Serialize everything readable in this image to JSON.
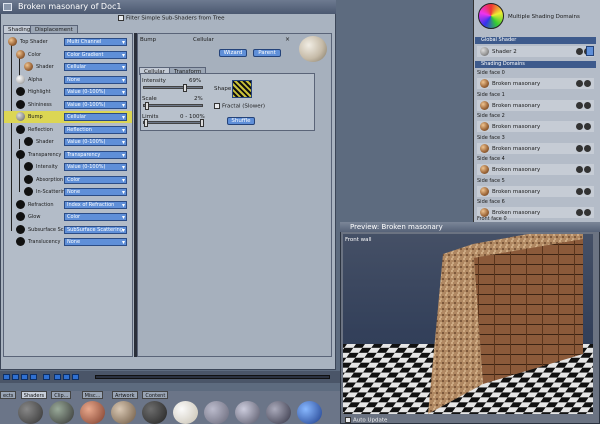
{
  "window": {
    "title": "Broken masonary of Doc1",
    "filter_label": "Filter Simple Sub-Shaders from Tree",
    "tabs": [
      "Shading",
      "Displacement"
    ]
  },
  "tree": [
    {
      "label": "Top Shader",
      "value": "Multi Channel",
      "ball": "brick"
    },
    {
      "label": "Color",
      "value": "Color Gradient",
      "ball": "brick"
    },
    {
      "label": "Shader",
      "value": "Cellular",
      "ball": "brick"
    },
    {
      "label": "Alpha",
      "value": "None",
      "ball": "white"
    },
    {
      "label": "Highlight",
      "value": "Value (0-100%)",
      "ball": "dark"
    },
    {
      "label": "Shininess",
      "value": "Value (0-100%)",
      "ball": "dark"
    },
    {
      "label": "Bump",
      "value": "Cellular",
      "ball": "grey"
    },
    {
      "label": "Reflection",
      "value": "Reflection",
      "ball": "dark"
    },
    {
      "label": "Shader",
      "value": "Value (0-100%)",
      "ball": "dark"
    },
    {
      "label": "Transparency",
      "value": "Transparency",
      "ball": "dark"
    },
    {
      "label": "Intensity",
      "value": "Value (0-100%)",
      "ball": "dark"
    },
    {
      "label": "Absorption",
      "value": "Color",
      "ball": "dark"
    },
    {
      "label": "In-Scattering",
      "value": "None",
      "ball": "dark"
    },
    {
      "label": "Refraction",
      "value": "Index of Refraction",
      "ball": "dark"
    },
    {
      "label": "Glow",
      "value": "Color",
      "ball": "dark"
    },
    {
      "label": "Subsurface Sc",
      "value": "SubSurface Scattering",
      "ball": "dark"
    },
    {
      "label": "Translucency",
      "value": "None",
      "ball": "dark"
    }
  ],
  "bump_panel": {
    "label": "Bump",
    "type": "Cellular",
    "wizard_label": "Wizard",
    "parent_label": "Parent",
    "tabs": [
      "Cellular",
      "Transform"
    ],
    "intensity_label": "Intensity",
    "intensity_value": "69%",
    "intensity_level": 0.69,
    "scale_label": "Scale",
    "scale_value": "2%",
    "scale_level": 0.02,
    "limits_label": "Limits",
    "limits_value": "0 - 100%",
    "shape_label": "Shape",
    "fractal_label": "Fractal (Slower)",
    "shuffle_label": "Shuffle"
  },
  "library_tabs": [
    "ects",
    "Shaders",
    "Clip...",
    "Misc...",
    "Artwork",
    "Content"
  ],
  "side_panel": {
    "multi_label": "Multiple Shading Domains",
    "global_header": "Global Shader",
    "global_shader": "Shader 2",
    "domains_header": "Shading Domains",
    "faces": [
      {
        "label": "Side face 0",
        "shader": "Broken masonary"
      },
      {
        "label": "Side face 1",
        "shader": "Broken masonary"
      },
      {
        "label": "Side face 2",
        "shader": "Broken masonary"
      },
      {
        "label": "Side face 3",
        "shader": "Broken masonary"
      },
      {
        "label": "Side face 4",
        "shader": "Broken masonary"
      },
      {
        "label": "Side face 5",
        "shader": "Broken masonary"
      },
      {
        "label": "Side face 6",
        "shader": "Broken masonary"
      }
    ],
    "partial_label": "Front face 0"
  },
  "preview": {
    "title": "Preview: Broken masonary",
    "view_label": "Front wall",
    "auto_update_label": "Auto Update"
  },
  "colors": {
    "accent": "#5f8fd8",
    "selection": "#dcd654"
  }
}
